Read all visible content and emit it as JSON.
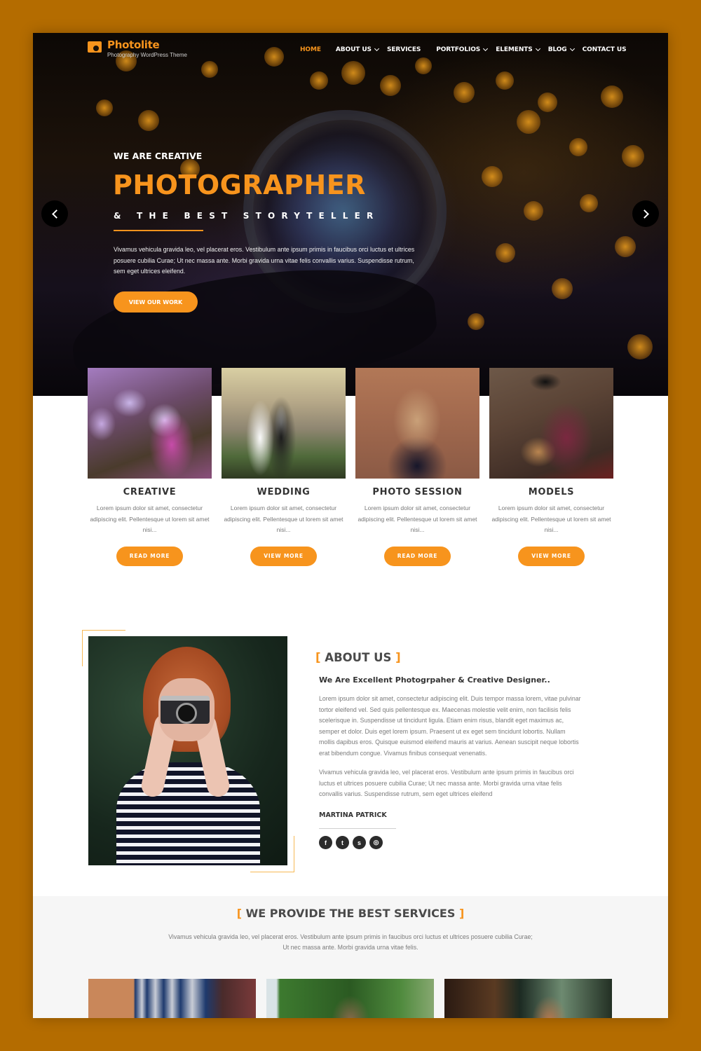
{
  "brand": {
    "name": "Photolite",
    "tagline": "Photography WordPress Theme",
    "accent_color": "#f7941d",
    "frame_color": "#b46c00"
  },
  "nav": {
    "items": [
      {
        "label": "HOME",
        "active": true,
        "dropdown": false
      },
      {
        "label": "ABOUT US",
        "active": false,
        "dropdown": true
      },
      {
        "label": "SERVICES",
        "active": false,
        "dropdown": false
      },
      {
        "label": "PORTFOLIOS",
        "active": false,
        "dropdown": true
      },
      {
        "label": "ELEMENTS",
        "active": false,
        "dropdown": true
      },
      {
        "label": "BLOG",
        "active": false,
        "dropdown": true
      },
      {
        "label": "CONTACT US",
        "active": false,
        "dropdown": false
      }
    ]
  },
  "hero": {
    "subtitle": "WE ARE CREATIVE",
    "title": "PHOTOGRAPHER",
    "tagline": "& THE BEST STORYTELLER",
    "description": "Vivamus vehicula gravida leo, vel placerat eros. Vestibulum ante ipsum primis in faucibus orci luctus et ultrices posuere cubilia Curae; Ut nec massa ante. Morbi gravida urna vitae felis convallis varius. Suspendisse rutrum, sem eget ultrices eleifend.",
    "cta_label": "VIEW OUR WORK",
    "prev_icon": "chevron-left-icon",
    "next_icon": "chevron-right-icon"
  },
  "categories": [
    {
      "title": "CREATIVE",
      "text": "Lorem ipsum dolor sit amet, consectetur adipiscing elit. Pellentesque ut lorem sit amet nisi...",
      "button": "READ MORE"
    },
    {
      "title": "WEDDING",
      "text": "Lorem ipsum dolor sit amet, consectetur adipiscing elit. Pellentesque ut lorem sit amet nisi...",
      "button": "VIEW MORE"
    },
    {
      "title": "PHOTO SESSION",
      "text": "Lorem ipsum dolor sit amet, consectetur adipiscing elit. Pellentesque ut lorem sit amet nisi...",
      "button": "READ MORE"
    },
    {
      "title": "MODELS",
      "text": "Lorem ipsum dolor sit amet, consectetur adipiscing elit. Pellentesque ut lorem sit amet nisi...",
      "button": "VIEW MORE"
    }
  ],
  "about": {
    "heading_open": "[",
    "heading": "ABOUT US",
    "heading_close": "]",
    "subheading": "We Are Excellent Photogrpaher & Creative Designer..",
    "paragraph1": "Lorem ipsum dolor sit amet, consectetur adipiscing elit. Duis tempor massa lorem, vitae pulvinar tortor eleifend vel. Sed quis pellentesque ex. Maecenas molestie velit enim, non facilisis felis scelerisque in. Suspendisse ut tincidunt ligula. Etiam enim risus, blandit eget maximus ac, semper et dolor. Duis eget lorem ipsum. Praesent ut ex eget sem tincidunt lobortis. Nullam mollis dapibus eros. Quisque euismod eleifend mauris at varius. Aenean suscipit neque lobortis erat bibendum congue. Vivamus finibus consequat venenatis.",
    "paragraph2": "Vivamus vehicula gravida leo, vel placerat eros. Vestibulum ante ipsum primis in faucibus orci luctus et ultrices posuere cubilia Curae; Ut nec massa ante. Morbi gravida urna vitae felis convallis varius. Suspendisse rutrum, sem eget ultrices eleifend",
    "author": "MARTINA PATRICK",
    "socials": [
      {
        "name": "facebook",
        "glyph": "f"
      },
      {
        "name": "twitter",
        "glyph": "t"
      },
      {
        "name": "skype",
        "glyph": "s"
      },
      {
        "name": "instagram",
        "glyph": "◎"
      }
    ]
  },
  "services": {
    "heading_open": "[",
    "heading": "WE PROVIDE THE BEST SERVICES",
    "heading_close": "]",
    "description": "Vivamus vehicula gravida leo, vel placerat eros. Vestibulum ante ipsum primis in faucibus orci luctus et ultrices posuere cubilia Curae; Ut nec massa ante. Morbi gravida urna vitae felis."
  }
}
